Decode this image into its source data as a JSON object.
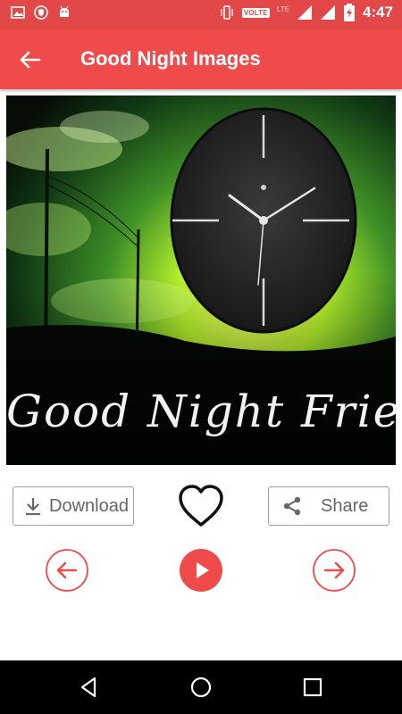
{
  "status_bar": {
    "time": "4:47",
    "volte_label": "VOLTE",
    "lte_label": "LTE",
    "icons": [
      "image-icon",
      "shield-icon",
      "android-icon",
      "vibrate-icon",
      "signal-icon",
      "battery-charging-icon"
    ]
  },
  "app_bar": {
    "title": "Good Night Images",
    "back_icon": "arrow-left-icon"
  },
  "image": {
    "caption": "Good Night Friends"
  },
  "actions": {
    "download_label": "Download",
    "share_label": "Share",
    "favorite_icon": "heart-outline-icon"
  },
  "player": {
    "prev_icon": "arrow-left-circle-icon",
    "play_icon": "play-icon",
    "next_icon": "arrow-right-circle-icon"
  },
  "nav_bar": {
    "icons": [
      "back-triangle-icon",
      "home-circle-icon",
      "recents-square-icon"
    ]
  },
  "colors": {
    "accent": "#f04b4b",
    "status_bar": "#e24848",
    "nav_bar": "#000000"
  }
}
